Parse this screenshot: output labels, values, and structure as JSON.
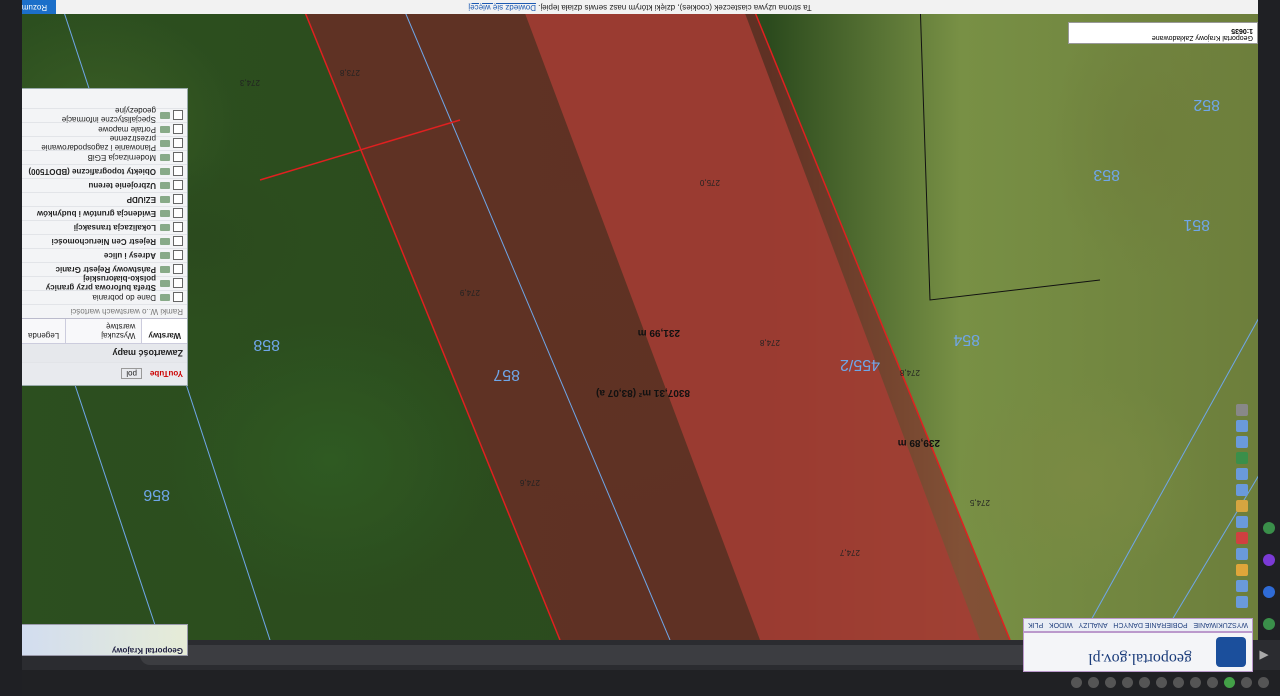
{
  "browser": {
    "url": "mapy.geoportal.gov.pl/imap/Imgp_2.html",
    "tab_count_hint": "many"
  },
  "cookie_bar": {
    "text": "Ta strona używa ciasteczek (cookies), dzięki którym nasz serwis działa lepiej.",
    "link": "Dowiedz się więcej",
    "ok": "Rozumiem"
  },
  "geoportal": {
    "logo": "geoportal.gov.pl",
    "menu": [
      "WYSZUKIWANIE",
      "POBIERANIE DANYCH",
      "ANALIZY",
      "WIDOK",
      "PLIK"
    ]
  },
  "scale_box": {
    "line1": "Geoportal Krajowy  Zakładowane",
    "line2": "1:0635",
    "line3": "Zoom  Zakładowane"
  },
  "side_panel": {
    "title": "Zawartość mapy",
    "tabs": [
      "Warstwy",
      "Wyszukaj warstwę",
      "Legenda"
    ],
    "search_placeholder": "Ramki W..o warstwach wartości",
    "layers": [
      "Dane do pobrania",
      "Strefa buforowa przy granicy polsko-białoruskiej",
      "Państwowy Rejestr Granic",
      "Adresy i ulice",
      "Rejestr Cen Nieruchomości",
      "Lokalizacja transakcji",
      "Ewidencja gruntów i budynków",
      "EZiUDP",
      "Uzbrojenie terenu",
      "Obiekty topograficzne (BDOT500)",
      "Modernizacja EGiB",
      "Planowanie i zagospodarowanie przestrzenne",
      "Portale mapowe",
      "Specjalistyczne informacje geodezyjne"
    ],
    "bottom_buttons": [
      "YouTube",
      "pol"
    ],
    "header": "Geoportal Krajowy"
  },
  "map": {
    "area_label": "8307,31 m² (83,07 a)",
    "length_left": "231,99 m",
    "length_right": "239,89 m",
    "parcel_main": "455/2",
    "parcels": [
      "858",
      "857",
      "856",
      "854",
      "853",
      "852",
      "851"
    ],
    "elevations": [
      "274,8",
      "275,0",
      "274,7",
      "274,8",
      "274,5",
      "274,6",
      "274,9",
      "273,8",
      "274,3"
    ]
  }
}
